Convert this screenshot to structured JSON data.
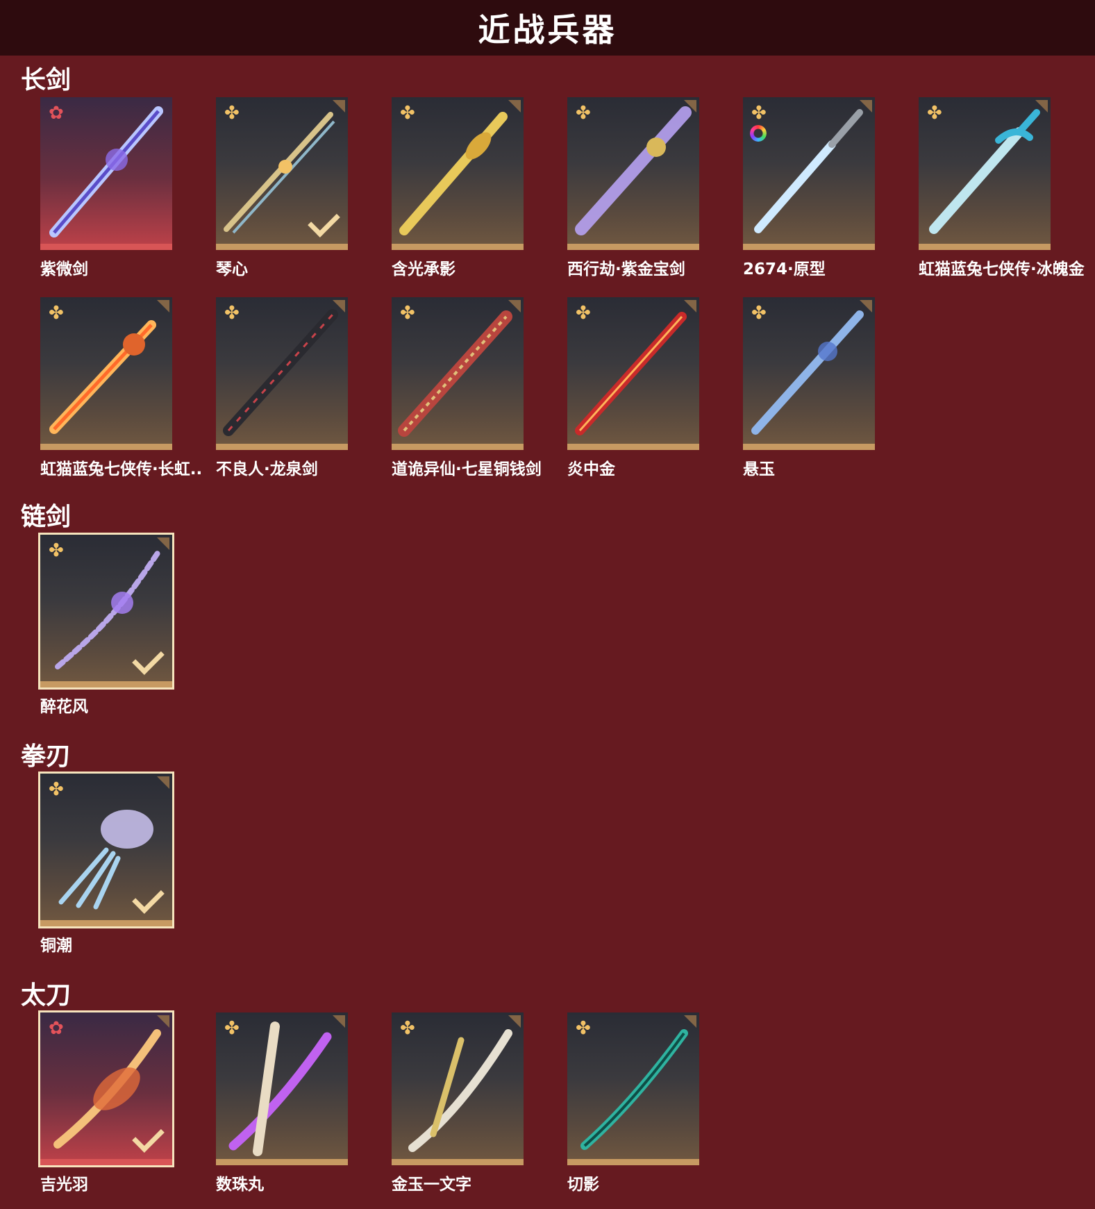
{
  "page_title": "近战兵器",
  "sections": {
    "changjian": {
      "title": "长剑"
    },
    "lianjian": {
      "title": "链剑"
    },
    "quanren": {
      "title": "拳刃"
    },
    "taidao": {
      "title": "太刀"
    }
  },
  "items": {
    "ziweijian": "紫微剑",
    "qinxin": "琴心",
    "hanguangchengying": "含光承影",
    "xixingjie": "西行劫·紫金宝剑",
    "yuanxing2674": "2674·原型",
    "hongmao_bingpo": "虹猫蓝兔七侠传·冰魄金",
    "hongmao_changhong": "虹猫蓝兔七侠传·长虹..",
    "longquanjian": "不良人·龙泉剑",
    "tongqianjian": "道诡异仙·七星铜钱剑",
    "yanzhongjin": "炎中金",
    "xuanyu": "悬玉",
    "zuihuafeng": "醉花风",
    "tongchao": "铜潮",
    "jiguangyu": "吉光羽",
    "shuzhuwan": "数珠丸",
    "jinyuyiwenzi": "金玉一文字",
    "qieying": "切影"
  },
  "icons": {
    "rarity_gold": "four-petal-flower-icon",
    "rarity_red": "red-star-flower-icon",
    "equipped": "checkmark-icon",
    "dye": "color-wheel-icon"
  },
  "colors": {
    "background": "#661a20",
    "header": "#2e0b0e",
    "frame_gold": "#c79a62",
    "frame_red": "#d85556"
  }
}
